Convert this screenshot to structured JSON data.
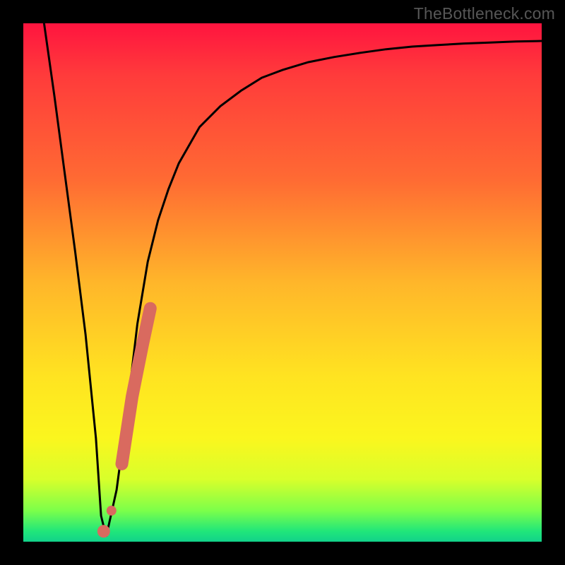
{
  "watermark": "TheBottleneck.com",
  "colors": {
    "background": "#000000",
    "gradient_top": "#ff143f",
    "gradient_mid": "#ffb62a",
    "gradient_low": "#fbf61e",
    "gradient_bottom": "#12d28a",
    "curve": "#000000",
    "marker": "#d96a5f"
  },
  "chart_data": {
    "type": "line",
    "title": "",
    "xlabel": "",
    "ylabel": "",
    "xlim": [
      0,
      100
    ],
    "ylim": [
      0,
      100
    ],
    "series": [
      {
        "name": "bottleneck-curve",
        "x": [
          4,
          6,
          8,
          10,
          12,
          14,
          15,
          16,
          18,
          20,
          22,
          24,
          26,
          28,
          30,
          34,
          38,
          42,
          46,
          50,
          55,
          60,
          65,
          70,
          75,
          80,
          85,
          90,
          95,
          100
        ],
        "values": [
          100,
          86,
          71,
          56,
          40,
          20,
          5,
          1,
          10,
          25,
          42,
          54,
          62,
          68,
          73,
          80,
          84,
          87,
          89.5,
          91,
          92.5,
          93.5,
          94.3,
          95,
          95.5,
          95.8,
          96.1,
          96.3,
          96.5,
          96.6
        ]
      }
    ],
    "markers": {
      "name": "highlighted-segment",
      "style": "thick-rounded",
      "color": "#d96a5f",
      "x": [
        15.5,
        17,
        19,
        21,
        23,
        24.5
      ],
      "values": [
        2,
        6,
        15,
        28,
        38,
        45
      ]
    }
  }
}
